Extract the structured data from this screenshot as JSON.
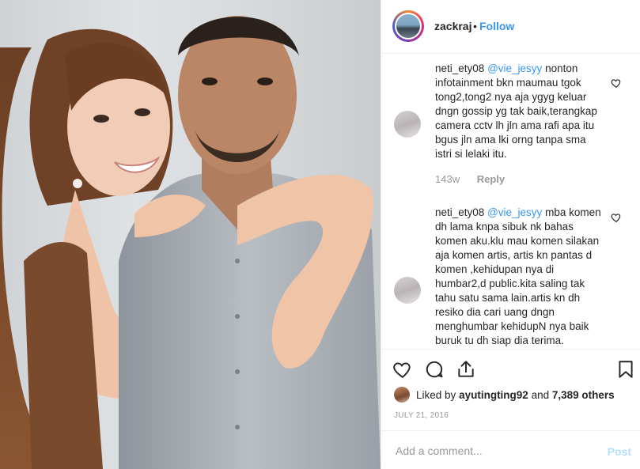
{
  "header": {
    "username": "zackraj",
    "separator": "•",
    "follow_label": "Follow"
  },
  "comments": [
    {
      "username": "neti_ety08",
      "mention": "@vie_jesyy",
      "text": "nonton infotainment bkn maumau tgok tong2,tong2 nya aja ygyg keluar dngn gossip yg tak baik,terangkap camera cctv lh jln ama rafi apa itu bgus jln ama lki orng tanpa sma istri si lelaki itu.",
      "time": "143w",
      "reply_label": "Reply"
    },
    {
      "username": "neti_ety08",
      "mention": "@vie_jesyy",
      "text": "mba komen dh lama knpa sibuk nk bahas komen aku.klu mau komen silakan aja komen artis, artis kn pantas d komen ,kehidupan nya di humbar2,d public.kita saling tak tahu satu sama lain.artis kn dh resiko dia cari uang dngn menghumbar kehidupN nya baik buruk tu dh siap dia terima.",
      "time": "",
      "reply_label": ""
    }
  ],
  "likes": {
    "prefix": "Liked by",
    "user": "ayutingting92",
    "connector": "and",
    "others": "7,389 others"
  },
  "date": "JULY 21, 2016",
  "add_comment": {
    "placeholder": "Add a comment...",
    "post_label": "Post"
  },
  "icons": {
    "like": "heart-icon",
    "comment": "comment-icon",
    "share": "share-icon",
    "save": "bookmark-icon",
    "comment_like": "heart-outline-icon"
  },
  "colors": {
    "link": "#3897f0",
    "muted": "#999999",
    "post_disabled": "#b2dffc"
  }
}
